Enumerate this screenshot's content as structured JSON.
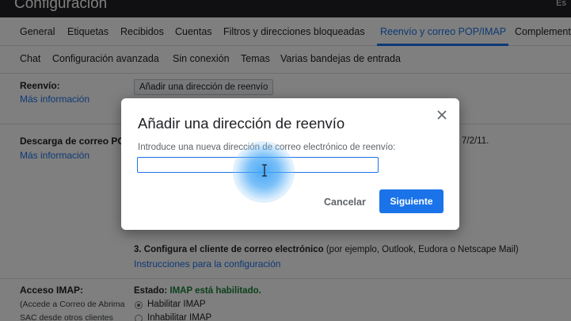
{
  "app": {
    "title": "Configuración",
    "top_right": "Es"
  },
  "tabs_row1": [
    {
      "label": "General"
    },
    {
      "label": "Etiquetas"
    },
    {
      "label": "Recibidos"
    },
    {
      "label": "Cuentas"
    },
    {
      "label": "Filtros y direcciones bloqueadas"
    },
    {
      "label": "Reenvío y correo POP/IMAP",
      "active": true
    },
    {
      "label": "Complementos"
    }
  ],
  "tabs_row2": [
    {
      "label": "Chat"
    },
    {
      "label": "Configuración avanzada"
    },
    {
      "label": "Sin conexión"
    },
    {
      "label": "Temas"
    },
    {
      "label": "Varias bandejas de entrada"
    }
  ],
  "forwarding": {
    "label": "Reenvío:",
    "more_info": "Más información",
    "add_button": "Añadir una dirección de reenvío"
  },
  "pop": {
    "label": "Descarga de correo POP",
    "more_info": "Más información",
    "date_fragment": "7/2/11.",
    "step3_bold": "3. Configura el cliente de correo electrónico",
    "step3_rest": " (por ejemplo, Outlook, Eudora o Netscape Mail)",
    "instructions_link": "Instrucciones para la configuración"
  },
  "imap": {
    "label": "Acceso IMAP:",
    "desc_line1": "(Accede a Correo de Abrima",
    "desc_line2": "SAC desde otros clientes",
    "status_label": "Estado: ",
    "status_value": "IMAP está habilitado.",
    "options": [
      "Habilitar IMAP",
      "Inhabilitar IMAP"
    ],
    "selected": "Habilitar IMAP"
  },
  "dialog": {
    "title": "Añadir una dirección de reenvío",
    "prompt": "Introduce una nueva dirección de correo electrónico de reenvío:",
    "input_value": "",
    "cancel_label": "Cancelar",
    "next_label": "Siguiente"
  },
  "colors": {
    "accent": "#1a73e8",
    "status_green": "#188038"
  }
}
